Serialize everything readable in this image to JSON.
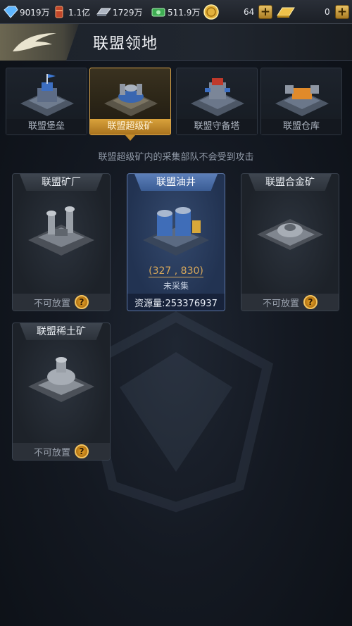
{
  "resources": {
    "crystal": "9019万",
    "oil": "1.1亿",
    "steel": "1729万",
    "cash": "511.9万",
    "gold_coin": "64",
    "gold_bar": "0"
  },
  "header": {
    "title": "联盟领地"
  },
  "tabs": [
    {
      "label": "联盟堡垒",
      "active": false
    },
    {
      "label": "联盟超级矿",
      "active": true
    },
    {
      "label": "联盟守备塔",
      "active": false
    },
    {
      "label": "联盟仓库",
      "active": false
    }
  ],
  "notice": "联盟超级矿内的采集部队不会受到攻击",
  "cards": [
    {
      "title": "联盟矿厂",
      "footer": "不可放置"
    },
    {
      "title": "联盟油井",
      "coords": "(327 , 830)",
      "status": "未采集",
      "footer": "资源量:253376937"
    },
    {
      "title": "联盟合金矿",
      "footer": "不可放置"
    },
    {
      "title": "联盟稀土矿",
      "footer": "不可放置"
    }
  ],
  "help_glyph": "?",
  "plus_glyph": "+",
  "colors": {
    "accent": "#d7a34a",
    "active_card": "#3b5d95",
    "coords": "#d8a85a"
  }
}
